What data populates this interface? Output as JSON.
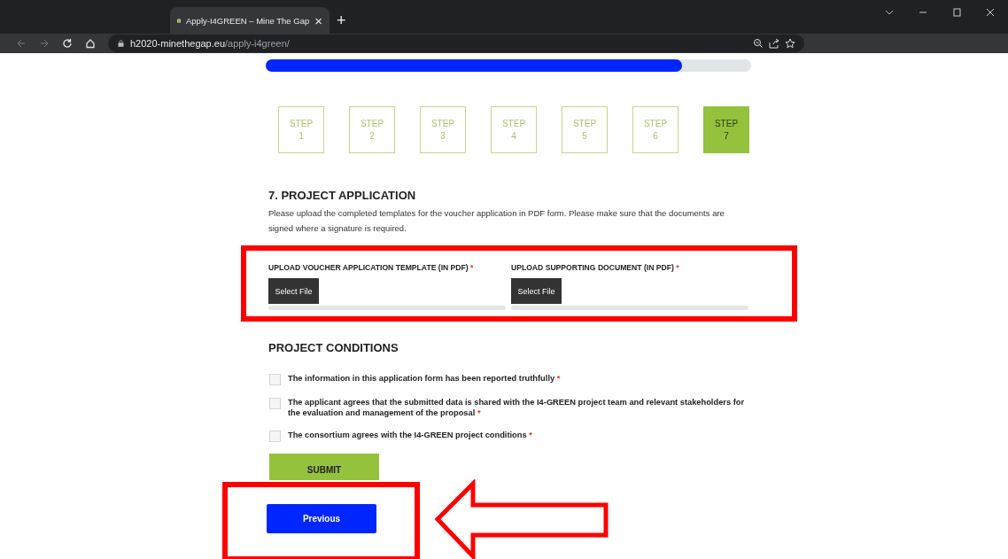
{
  "browser": {
    "tab_title": "Apply-I4GREEN – Mine The Gap",
    "close": "×",
    "new_tab": "+",
    "url_host": "h2020-minethegap.eu",
    "url_path": "/apply-i4green/"
  },
  "progress": {
    "level": 0.857
  },
  "steps": [
    {
      "label": "STEP",
      "number": "1",
      "selected": false
    },
    {
      "label": "STEP",
      "number": "2",
      "selected": false
    },
    {
      "label": "STEP",
      "number": "3",
      "selected": false
    },
    {
      "label": "STEP",
      "number": "4",
      "selected": false
    },
    {
      "label": "STEP",
      "number": "5",
      "selected": false
    },
    {
      "label": "STEP",
      "number": "6",
      "selected": false
    },
    {
      "label": "STEP",
      "number": "7",
      "selected": true
    }
  ],
  "section": {
    "title": "7. PROJECT APPLICATION",
    "description": "Please upload the completed templates for the voucher application in PDF form. Please make sure that the documents are signed where a signature is required."
  },
  "uploads": [
    {
      "label": "UPLOAD VOUCHER APPLICATION TEMPLATE (IN PDF)",
      "required_mark": "*",
      "button": "Select File"
    },
    {
      "label": "UPLOAD SUPPORTING DOCUMENT (IN PDF)",
      "required_mark": "*",
      "button": "Select File"
    }
  ],
  "conditions": {
    "title": "PROJECT CONDITIONS",
    "items": [
      {
        "text": "The information in this application form has been reported truthfully",
        "required_mark": "*",
        "checked": false
      },
      {
        "text": "The applicant agrees that the submitted data is shared with the I4-GREEN project team and relevant stakeholders for the evaluation and management of the proposal",
        "required_mark": "*",
        "checked": false
      },
      {
        "text": "The consortium agrees with the I4-GREEN project conditions",
        "required_mark": "*",
        "checked": false
      }
    ]
  },
  "submit": "SUBMIT",
  "previous": "Previous",
  "annotations": [
    {
      "kind": "box"
    },
    {
      "kind": "box"
    },
    {
      "kind": "arrow"
    }
  ]
}
